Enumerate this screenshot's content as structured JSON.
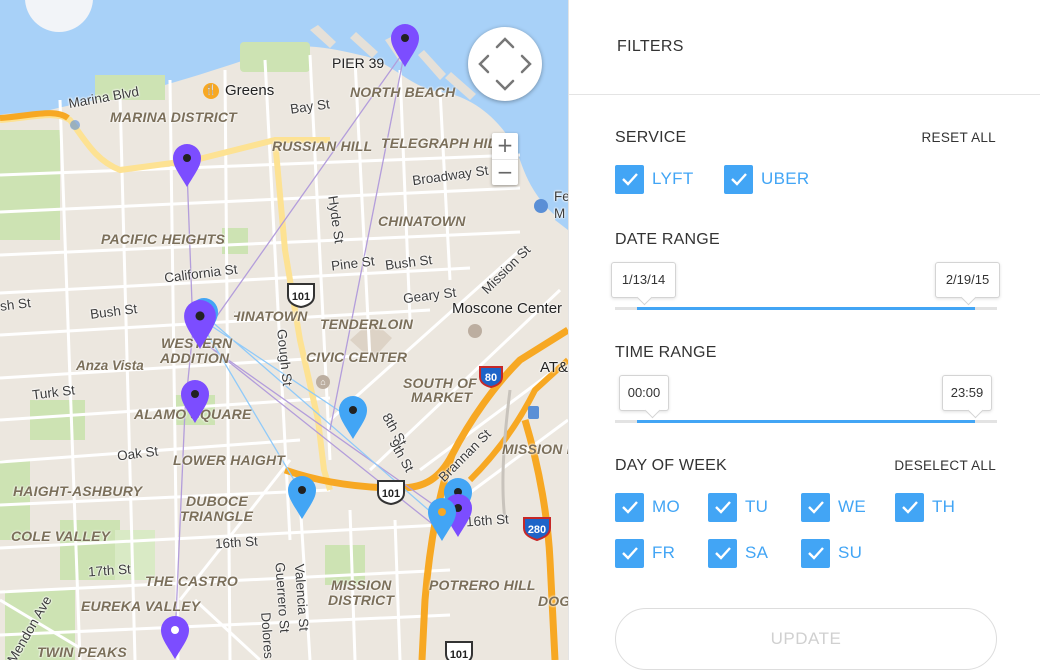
{
  "map": {
    "neighborhoods": [
      "MARINA DISTRICT",
      "NORTH BEACH",
      "TELEGRAPH HILL",
      "RUSSIAN HILL",
      "CHINATOWN",
      "PACIFIC HEIGHTS",
      "CHINATOWN",
      "TENDERLOIN",
      "WESTERN",
      "ADDITION",
      "CIVIC CENTER",
      "SOUTH OF",
      "MARKET",
      "ALAMO SQUARE",
      "LOWER HAIGHT",
      "HAIGHT-ASHBURY",
      "DUBOCE",
      "TRIANGLE",
      "COLE VALLEY",
      "THE CASTRO",
      "MISSION",
      "DISTRICT",
      "POTRERO HILL",
      "EUREKA VALLEY",
      "TWIN PEAKS",
      "MISSION BAY",
      "DOG"
    ],
    "streets": [
      "Marina Blvd",
      "Bay St",
      "Broadway St",
      "Hyde St",
      "California St",
      "Pine St",
      "Bush St",
      "Mission St",
      "Geary St",
      "Bush St",
      "Gough St",
      "Anza Vista",
      "Turk St",
      "Oak St",
      "8th St",
      "9th St",
      "Brannan St",
      "16th St",
      "16th St",
      "17th St",
      "Guerrero St",
      "Valencia St",
      "Dolores",
      "Mendon Ave",
      "sh St",
      "Fe",
      "M",
      "AT&"
    ],
    "pois": [
      "PIER 39",
      "Greens",
      "Moscone Center"
    ],
    "shields": [
      "101",
      "80",
      "101",
      "280",
      "101"
    ]
  },
  "filters": {
    "title": "FILTERS",
    "service": {
      "heading": "SERVICE",
      "reset": "RESET ALL",
      "options": [
        {
          "label": "LYFT",
          "checked": true
        },
        {
          "label": "UBER",
          "checked": true
        }
      ]
    },
    "date_range": {
      "heading": "DATE RANGE",
      "start": "1/13/14",
      "end": "2/19/15"
    },
    "time_range": {
      "heading": "TIME RANGE",
      "start": "00:00",
      "end": "23:59"
    },
    "day_of_week": {
      "heading": "DAY OF WEEK",
      "deselect": "DESELECT ALL",
      "days": [
        {
          "label": "MO",
          "checked": true
        },
        {
          "label": "TU",
          "checked": true
        },
        {
          "label": "WE",
          "checked": true
        },
        {
          "label": "TH",
          "checked": true
        },
        {
          "label": "FR",
          "checked": true
        },
        {
          "label": "SA",
          "checked": true
        },
        {
          "label": "SU",
          "checked": true
        }
      ]
    },
    "update": "UPDATE"
  },
  "colors": {
    "accent": "#42a5f5",
    "lyft": "#7c4dff",
    "uber": "#42a5f5",
    "highway": "#f7a823",
    "water": "#a8d1f8"
  }
}
